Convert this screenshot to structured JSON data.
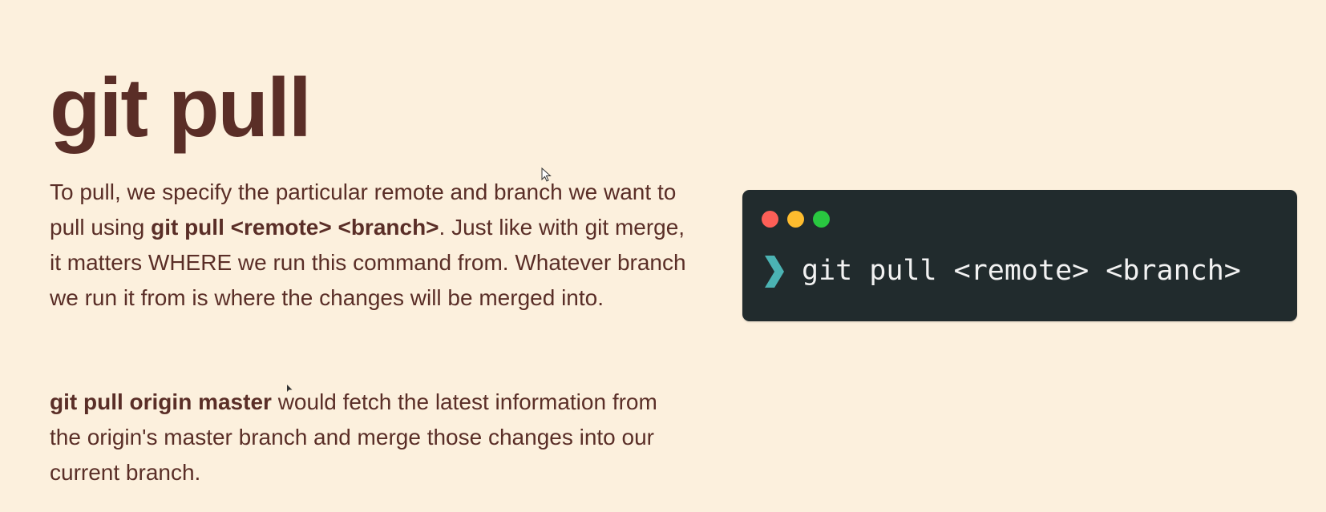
{
  "slide": {
    "title": "git pull",
    "paragraph1": {
      "before_command": "To pull, we specify the particular remote and branch we want to pull using ",
      "command": "git pull <remote> <branch>",
      "after_command": ".  Just like with git merge, it matters WHERE we run this command from.  Whatever branch we run it from is where the changes will be merged into."
    },
    "paragraph2": {
      "command": "git pull origin master",
      "after_command": " would fetch the latest information from the origin's master branch and merge those changes into our current branch."
    }
  },
  "terminal": {
    "command": "git pull <remote> <branch>",
    "background_color": "#212b2d",
    "prompt_color": "#4bb3b3",
    "window_controls": {
      "close_color": "#fe5f57",
      "minimize_color": "#febc2e",
      "maximize_color": "#29c840"
    }
  },
  "colors": {
    "background": "#fcf0dd",
    "text": "#5a2e27"
  }
}
